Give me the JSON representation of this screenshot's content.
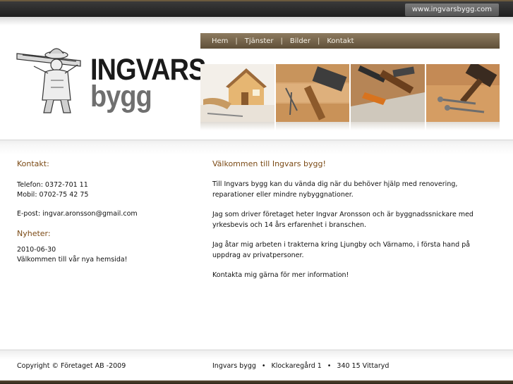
{
  "header": {
    "domain_label": "www.ingvarsbygg.com"
  },
  "logo": {
    "word1": "INGVARS",
    "word2": "bygg",
    "image": "carpenter-carrying-plank"
  },
  "nav": {
    "items": [
      "Hem",
      "Tjänster",
      "Bilder",
      "Kontakt"
    ],
    "separator": "|"
  },
  "gallery": {
    "images": [
      "house-and-tools",
      "hammer-and-nails",
      "carpenter-tools",
      "nails-and-hammer"
    ]
  },
  "sidebar": {
    "contact_heading": "Kontakt:",
    "phone": "Telefon: 0372-701 11",
    "mobile": "Mobil: 0702-75 42 75",
    "email": "E-post: ingvar.aronsson@gmail.com",
    "news_heading": "Nyheter:",
    "news_date": "2010-06-30",
    "news_text": "Välkommen till vår nya hemsida!"
  },
  "main": {
    "title": "Välkommen till Ingvars bygg!",
    "paragraphs": [
      "Till Ingvars bygg kan du vända dig när du behöver hjälp med renovering, reparationer eller mindre nybyggnationer.",
      "Jag som driver företaget heter Ingvar Aronsson och är byggnadssnickare med yrkesbevis och 14 års erfarenhet i branschen.",
      "Jag åtar mig arbeten i trakterna kring Ljungby och Värnamo, i första hand på uppdrag av privatpersoner.",
      "Kontakta mig gärna för mer information!"
    ]
  },
  "footer": {
    "copyright": "Copyright © Företaget AB -2009",
    "company": "Ingvars bygg",
    "address": "Klockaregård 1",
    "postal": "340 15 Vittaryd",
    "bullet": "•"
  },
  "colors": {
    "accent_brown": "#7b4a15",
    "nav_brown": "#6f5e44"
  }
}
